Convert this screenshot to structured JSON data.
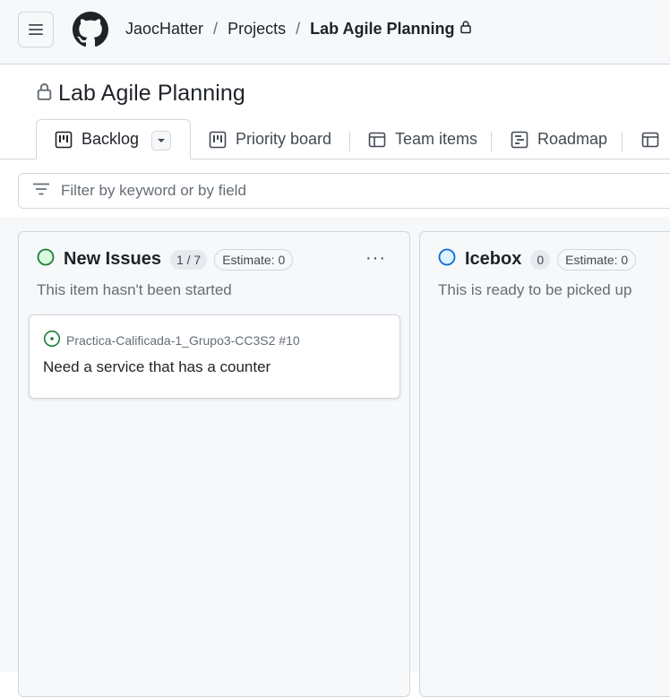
{
  "header": {
    "owner": "JaocHatter",
    "projects": "Projects",
    "project": "Lab Agile Planning",
    "separator": "/"
  },
  "project_title": "Lab Agile Planning",
  "tabs": [
    {
      "label": "Backlog",
      "active": true
    },
    {
      "label": "Priority board"
    },
    {
      "label": "Team items"
    },
    {
      "label": "Roadmap"
    }
  ],
  "filter": {
    "placeholder": "Filter by keyword or by field"
  },
  "columns": [
    {
      "name": "New Issues",
      "count": "1 / 7",
      "estimate": "Estimate: 0",
      "description": "This item hasn't been started",
      "status_color": "#1a7f37",
      "more": "···",
      "cards": [
        {
          "repo": "Practica-Calificada-1_Grupo3-CC3S2 #10",
          "title": "Need a service that has a counter"
        }
      ]
    },
    {
      "name": "Icebox",
      "count": "0",
      "estimate": "Estimate: 0",
      "description": "This is ready to be picked up",
      "status_color": "#0969da"
    }
  ]
}
